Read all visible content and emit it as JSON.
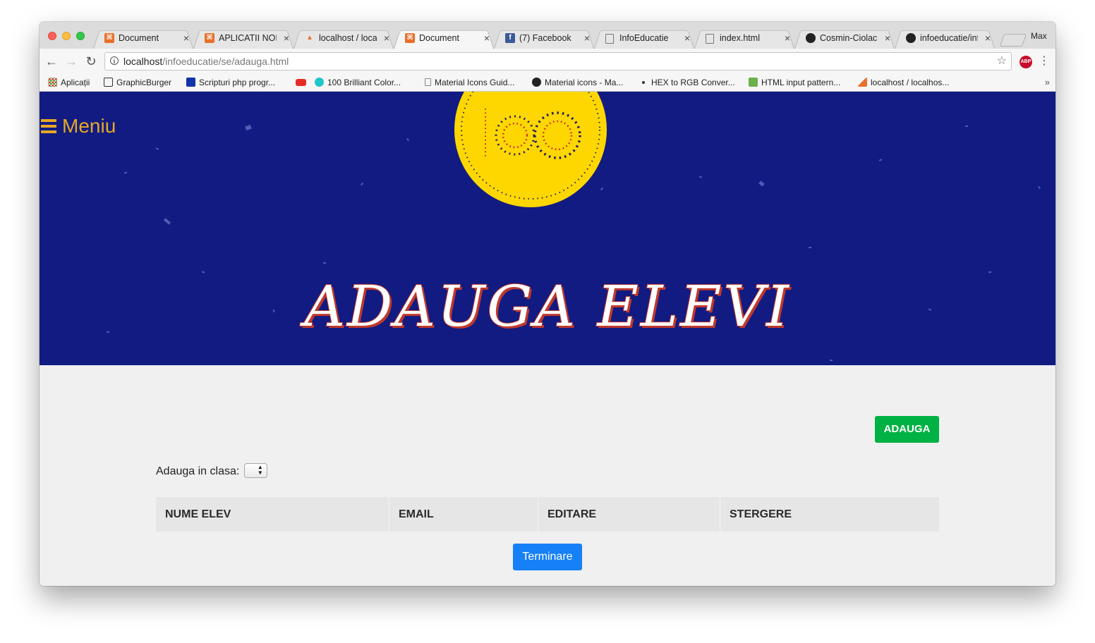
{
  "browser": {
    "tabs": [
      {
        "title": "Document",
        "favicon": "xampp-icon",
        "active": false
      },
      {
        "title": "APLICATII NOI",
        "favicon": "xampp-icon",
        "active": false
      },
      {
        "title": "localhost / local",
        "favicon": "phpmyadmin-icon",
        "active": false
      },
      {
        "title": "Document",
        "favicon": "xampp-icon",
        "active": true
      },
      {
        "title": "(7) Facebook",
        "favicon": "facebook-icon",
        "active": false
      },
      {
        "title": "InfoEducatie",
        "favicon": "document-icon",
        "active": false
      },
      {
        "title": "index.html",
        "favicon": "document-icon",
        "active": false
      },
      {
        "title": "Cosmin-Ciolacu",
        "favicon": "github-icon",
        "active": false
      },
      {
        "title": "infoeducatie/inf",
        "favicon": "github-icon",
        "active": false
      }
    ],
    "profile_label": "Max",
    "url_host": "localhost",
    "url_path": "/infoeducatie/se/adauga.html",
    "bookmarks": [
      {
        "label": "Aplicații",
        "icon": "apps-grid-icon"
      },
      {
        "label": "GraphicBurger",
        "icon": "graphicburger-icon"
      },
      {
        "label": "Scripturi php progr...",
        "icon": "mp-icon"
      },
      {
        "label": "",
        "icon": "youtube-icon"
      },
      {
        "label": "100 Brilliant Color...",
        "icon": "canva-icon"
      },
      {
        "label": "Material Icons Guid...",
        "icon": "document-icon"
      },
      {
        "label": "Material icons - Ma...",
        "icon": "github-icon"
      },
      {
        "label": "HEX to RGB Conver...",
        "icon": "dot-icon"
      },
      {
        "label": "HTML input pattern...",
        "icon": "w3-icon"
      },
      {
        "label": "localhost / localhos...",
        "icon": "phpmyadmin-icon"
      }
    ]
  },
  "page": {
    "menu_label": "Meniu",
    "logo_text": "100",
    "title": "ADAUGA ELEVI",
    "add_button": "ADAUGA",
    "class_label": "Adauga in clasa:",
    "table_headers": [
      "NUME ELEV",
      "EMAIL",
      "EDITARE",
      "STERGERE"
    ],
    "finish_button": "Terminare"
  },
  "colors": {
    "hero_bg": "#111b82",
    "menu_accent": "#e6a825",
    "logo_yellow": "#fed701",
    "title_red": "#c0392b",
    "add_green": "#00b244",
    "finish_blue": "#1680f6"
  }
}
